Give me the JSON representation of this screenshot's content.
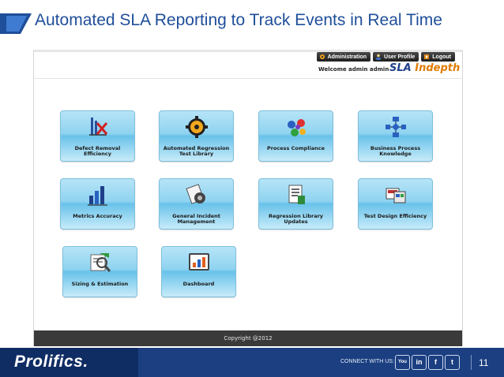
{
  "slide": {
    "title": "Automated SLA Reporting to Track Events in Real Time",
    "page_number": "11"
  },
  "app": {
    "nav": {
      "administration": "Administration",
      "user_profile": "User Profile",
      "logout": "Logout"
    },
    "welcome_text": "Welcome admin admin",
    "logo": {
      "part1": "SLA ",
      "part2": "Indepth"
    },
    "tiles": [
      {
        "label": "Defect Removal\nEfficiency",
        "icon": "defect-removal-icon"
      },
      {
        "label": "Automated Regression\nTest Library",
        "icon": "gear-icon"
      },
      {
        "label": "Process Compliance",
        "icon": "process-compliance-icon"
      },
      {
        "label": "Business Process\nKnowledge",
        "icon": "flowchart-icon"
      },
      {
        "label": "Metrics Accuracy",
        "icon": "bar-chart-icon"
      },
      {
        "label": "General Incident\nManagement",
        "icon": "incident-icon"
      },
      {
        "label": "Regression Library\nUpdates",
        "icon": "document-icon"
      },
      {
        "label": "Test Design Efficiency",
        "icon": "test-design-icon"
      },
      {
        "label": "Sizing & Estimation",
        "icon": "sizing-icon"
      },
      {
        "label": "Dashboard",
        "icon": "dashboard-icon"
      }
    ],
    "footer_text": "Copyright @2012"
  },
  "footer": {
    "brand": "Prolifics.",
    "connect_text": "CONNECT WITH US:",
    "social": {
      "youtube": "You",
      "linkedin": "in",
      "facebook": "f",
      "twitter": "t"
    }
  },
  "colors": {
    "title": "#1f4e9a",
    "footer_bar": "#1b3f80",
    "tile_blue": "#8fd3f0",
    "logo_orange": "#e07b00"
  }
}
